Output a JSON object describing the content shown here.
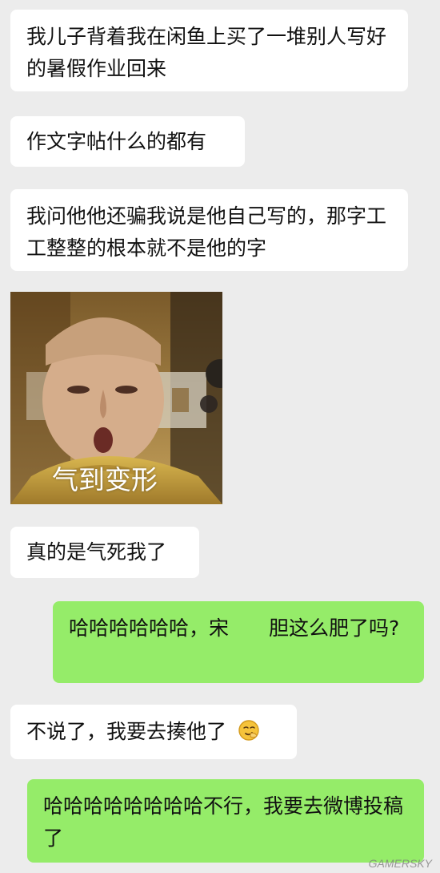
{
  "messages": [
    {
      "direction": "incoming",
      "text": "我儿子背着我在闲鱼上买了一堆别人写好的暑假作业回来"
    },
    {
      "direction": "incoming",
      "text": "作文字帖什么的都有"
    },
    {
      "direction": "incoming",
      "text": "我问他他还骗我说是他自己写的，那字工工整整的根本就不是他的字"
    },
    {
      "direction": "incoming",
      "type": "sticker",
      "caption": "气到变形"
    },
    {
      "direction": "incoming",
      "text": "真的是气死我了"
    },
    {
      "direction": "outgoing",
      "text": "哈哈哈哈哈哈，宋　　胆这么肥了吗?"
    },
    {
      "direction": "incoming",
      "text": "不说了，我要去揍他了",
      "emoji": "smirk-hand-emoji"
    },
    {
      "direction": "outgoing",
      "text": "哈哈哈哈哈哈哈哈不行，我要去微博投稿了"
    }
  ],
  "watermark": "GAMERSKY",
  "colors": {
    "background": "#ececec",
    "incoming_bubble": "#ffffff",
    "outgoing_bubble": "#95ec69",
    "text": "#111111"
  }
}
